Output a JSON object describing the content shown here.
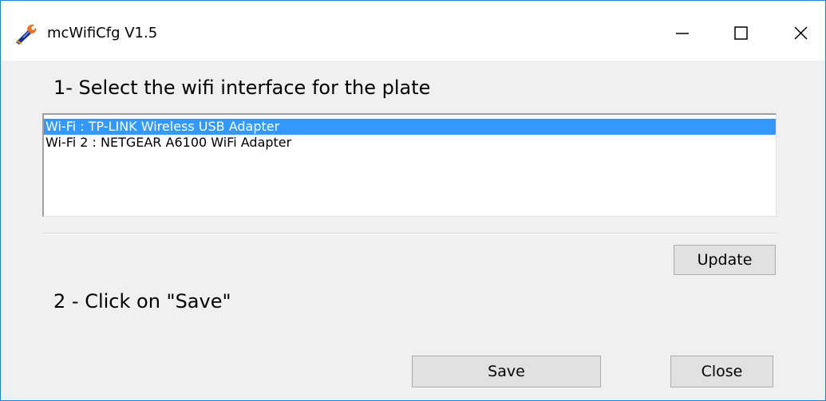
{
  "window": {
    "title": "mcWifiCfg V1.5"
  },
  "step1": {
    "heading": "1- Select the wifi interface for the plate"
  },
  "interfaces": {
    "items": [
      {
        "label": "Wi-Fi : TP-LINK Wireless USB Adapter",
        "selected": true
      },
      {
        "label": "Wi-Fi 2 : NETGEAR A6100 WiFi Adapter",
        "selected": false
      }
    ]
  },
  "buttons": {
    "update_label": "Update",
    "save_label": "Save",
    "close_label": "Close"
  },
  "step2": {
    "heading": "2 - Click on \"Save\""
  },
  "colors": {
    "selection": "#3399ff",
    "window_border": "#1883d7",
    "window_bg": "#f0f0f0",
    "button_bg": "#e1e1e1"
  },
  "icons": {
    "app": "wrench-app-icon",
    "minimize": "minimize-icon",
    "maximize": "maximize-icon",
    "close": "close-icon"
  }
}
